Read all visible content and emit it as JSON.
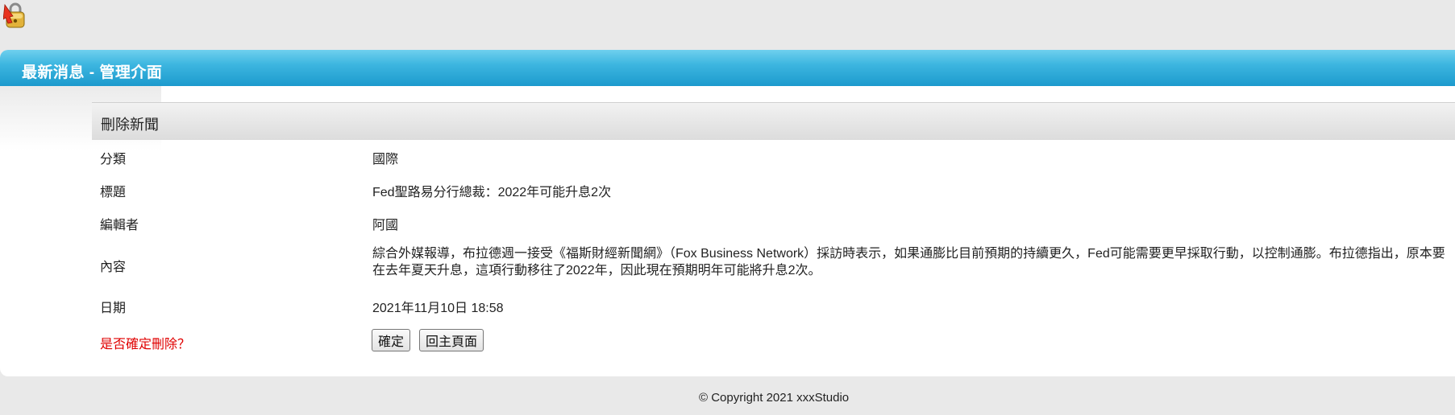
{
  "header": {
    "logo_icon": "lock-icon",
    "title": "最新消息 - 管理介面"
  },
  "section": {
    "title": "刪除新聞"
  },
  "rows": {
    "category": {
      "label": "分類",
      "value": "國際"
    },
    "headline": {
      "label": "標題",
      "value": "Fed聖路易分行總裁：2022年可能升息2次"
    },
    "editor": {
      "label": "編輯者",
      "value": "阿國"
    },
    "content": {
      "label": "內容",
      "value": "綜合外媒報導，布拉德週一接受《福斯財經新聞網》（Fox Business Network）採訪時表示，如果通膨比目前預期的持續更久，Fed可能需要更早採取行動，以控制通膨。布拉德指出，原本要在去年夏天升息，這項行動移往了2022年，因此現在預期明年可能將升息2次。"
    },
    "date": {
      "label": "日期",
      "value": "2021年11月10日 18:58"
    }
  },
  "confirm": {
    "prompt": "是否確定刪除？",
    "ok_label": "確定",
    "back_label": "回主頁面"
  },
  "footer": {
    "copyright": "© Copyright 2021 xxxStudio"
  },
  "colors": {
    "header_blue": "#1c9acd",
    "confirm_red": "#e00000",
    "background": "#e9e9e9"
  }
}
